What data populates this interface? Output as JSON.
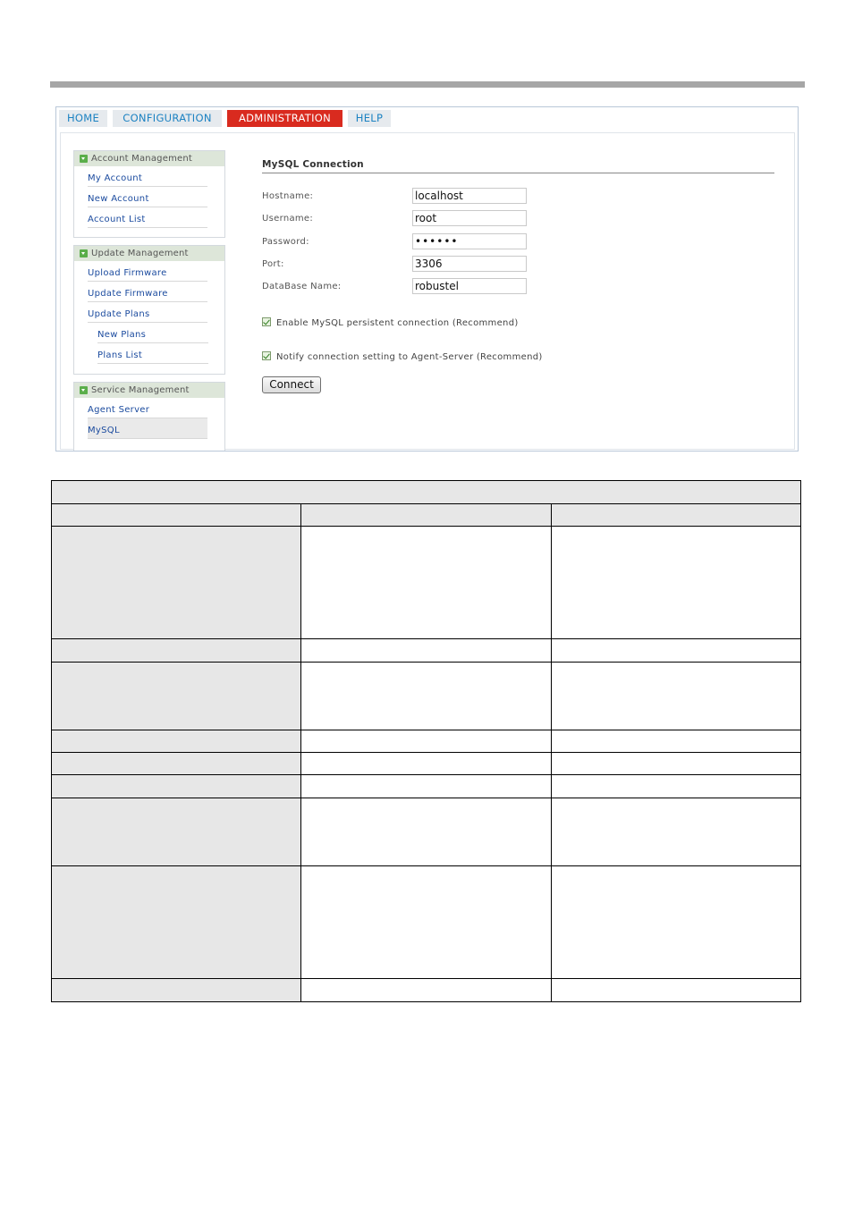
{
  "tabs": [
    {
      "label": "HOME"
    },
    {
      "label": "CONFIGURATION"
    },
    {
      "label": "ADMINISTRATION",
      "active": true
    },
    {
      "label": "HELP"
    }
  ],
  "sidebar": {
    "groups": [
      {
        "title": "Account Management",
        "items": [
          "My Account",
          "New Account",
          "Account List"
        ]
      },
      {
        "title": "Update Management",
        "items": [
          "Upload Firmware",
          "Update Firmware",
          "Update Plans",
          "New Plans",
          "Plans List"
        ]
      },
      {
        "title": "Service Management",
        "items": [
          "Agent Server",
          "MySQL"
        ]
      }
    ],
    "selected": "MySQL"
  },
  "form": {
    "title": "MySQL Connection",
    "fields": [
      {
        "label": "Hostname:",
        "value": "localhost"
      },
      {
        "label": "Username:",
        "value": "root"
      },
      {
        "label": "Password:",
        "value": "••••••"
      },
      {
        "label": "Port:",
        "value": "3306"
      },
      {
        "label": "DataBase Name:",
        "value": "robustel"
      }
    ],
    "checkboxes": [
      {
        "label": "Enable MySQL persistent connection (Recommend)",
        "checked": true
      },
      {
        "label": "Notify connection setting to Agent-Server (Recommend)",
        "checked": true
      }
    ],
    "connect_label": "Connect"
  },
  "colors": {
    "tab_active": "#d92b1f",
    "tab_text": "#1c82c2",
    "link": "#1a4a9e",
    "menu_head_bg": "#dde6d9"
  }
}
